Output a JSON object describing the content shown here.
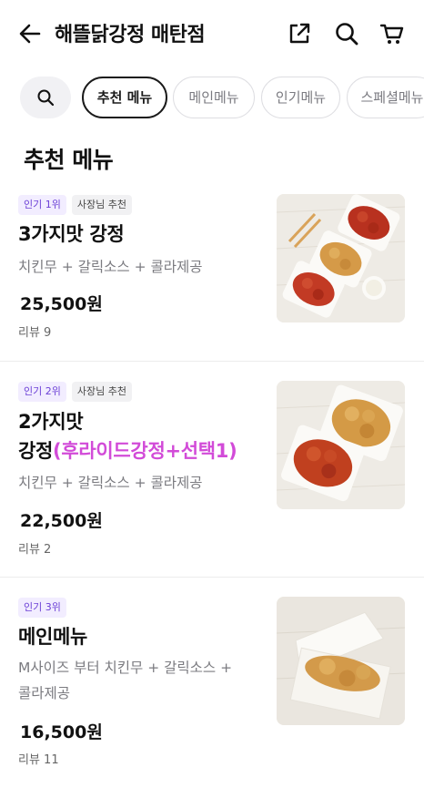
{
  "header": {
    "store_name": "해뜰닭강정 매탄점"
  },
  "chips": [
    "추천 메뉴",
    "메인메뉴",
    "인기메뉴",
    "스페셜메뉴"
  ],
  "section_title": "추천 메뉴",
  "items": [
    {
      "rank_badge": "인기 1위",
      "owner_badge": "사장님 추천",
      "name": "3가지맛 강정",
      "description": "치킨무 + 갈릭소스 + 콜라제공",
      "price": "25,500원",
      "reviews": "리뷰 9"
    },
    {
      "rank_badge": "인기 2위",
      "owner_badge": "사장님 추천",
      "name_line1": "2가지맛",
      "name_line2_main": "강정",
      "name_line2_paren": "(후라이드강정+선택1)",
      "description": "치킨무 + 갈릭소스 + 콜라제공",
      "price": "22,500원",
      "reviews": "리뷰 2"
    },
    {
      "rank_badge": "인기 3위",
      "name": "메인메뉴",
      "description_line1": "M사이즈 부터 치킨무 + 갈릭소스 +",
      "description_line2": "콜라제공",
      "price": "16,500원",
      "reviews": "리뷰 11"
    }
  ]
}
